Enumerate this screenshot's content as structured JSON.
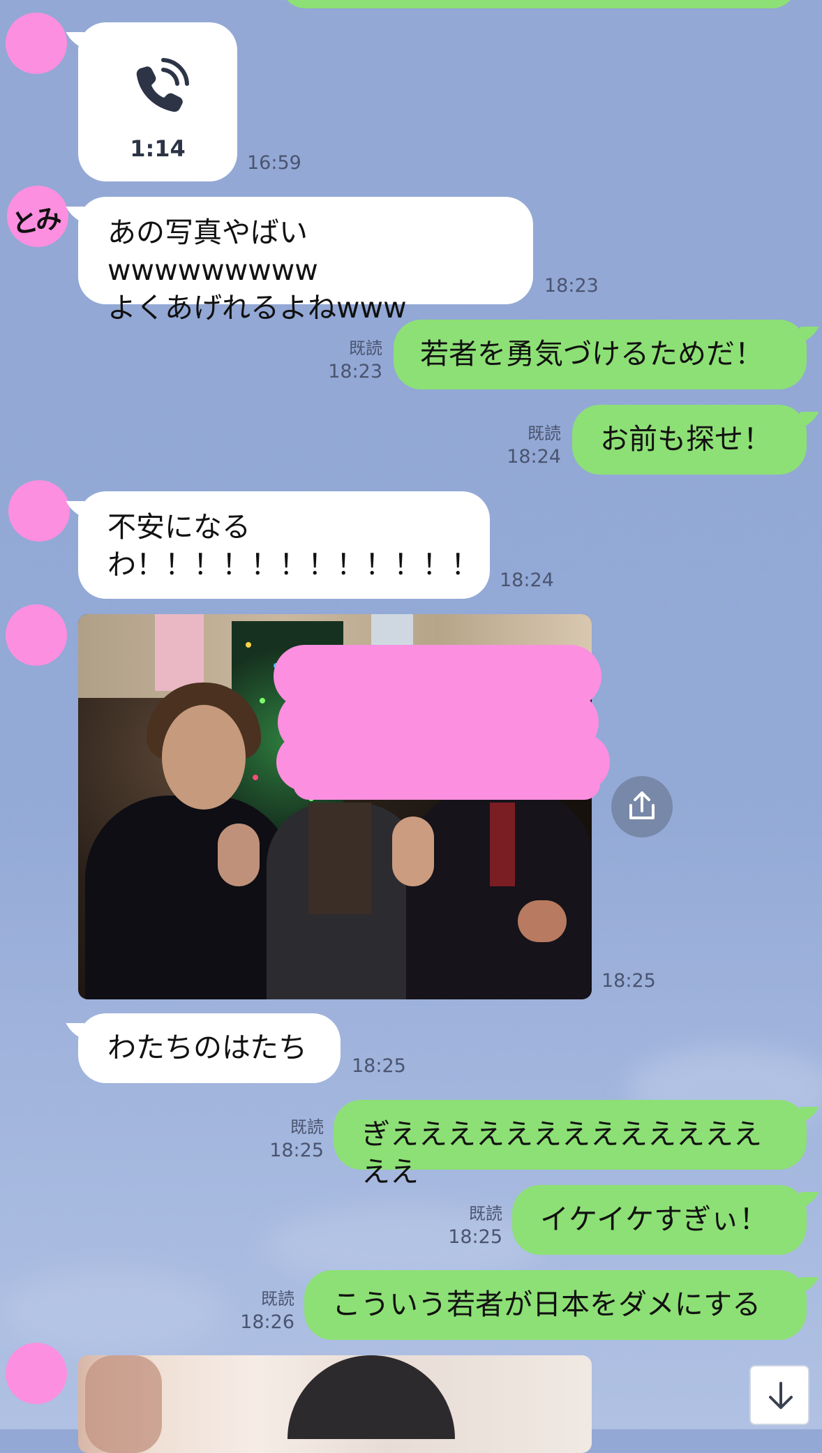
{
  "call": {
    "duration": "1:14",
    "time": "16:59",
    "icon": "phone-call-icon"
  },
  "avatar_label": "とみ",
  "messages": [
    {
      "line1": "あの写真やばいwwwwwwwww",
      "line2": "よくあげれるよねwww",
      "time": "18:23"
    },
    {
      "text": "若者を勇気づけるためだ！",
      "read": "既読",
      "time": "18:23"
    },
    {
      "text": "お前も探せ！",
      "read": "既読",
      "time": "18:24"
    },
    {
      "line1": "不安になる",
      "line2": "わ！！！！！！！！！！！！",
      "time": "18:24"
    },
    {
      "time": "18:25"
    },
    {
      "text": "わたちのはたち",
      "time": "18:25"
    },
    {
      "text": "ぎえええええええええええええええ",
      "read": "既読",
      "time": "18:25"
    },
    {
      "text": "イケイケすぎぃ！",
      "read": "既読",
      "time": "18:25"
    },
    {
      "text": "こういう若者が日本をダメにする",
      "read": "既読",
      "time": "18:26"
    }
  ],
  "colors": {
    "background": "#93a8d4",
    "incoming_bubble": "#ffffff",
    "outgoing_bubble": "#8de075",
    "avatar": "#fc8fe0",
    "redaction": "#fc8fe0"
  },
  "icons": {
    "share": "share-icon",
    "scroll_down": "arrow-down-icon"
  }
}
